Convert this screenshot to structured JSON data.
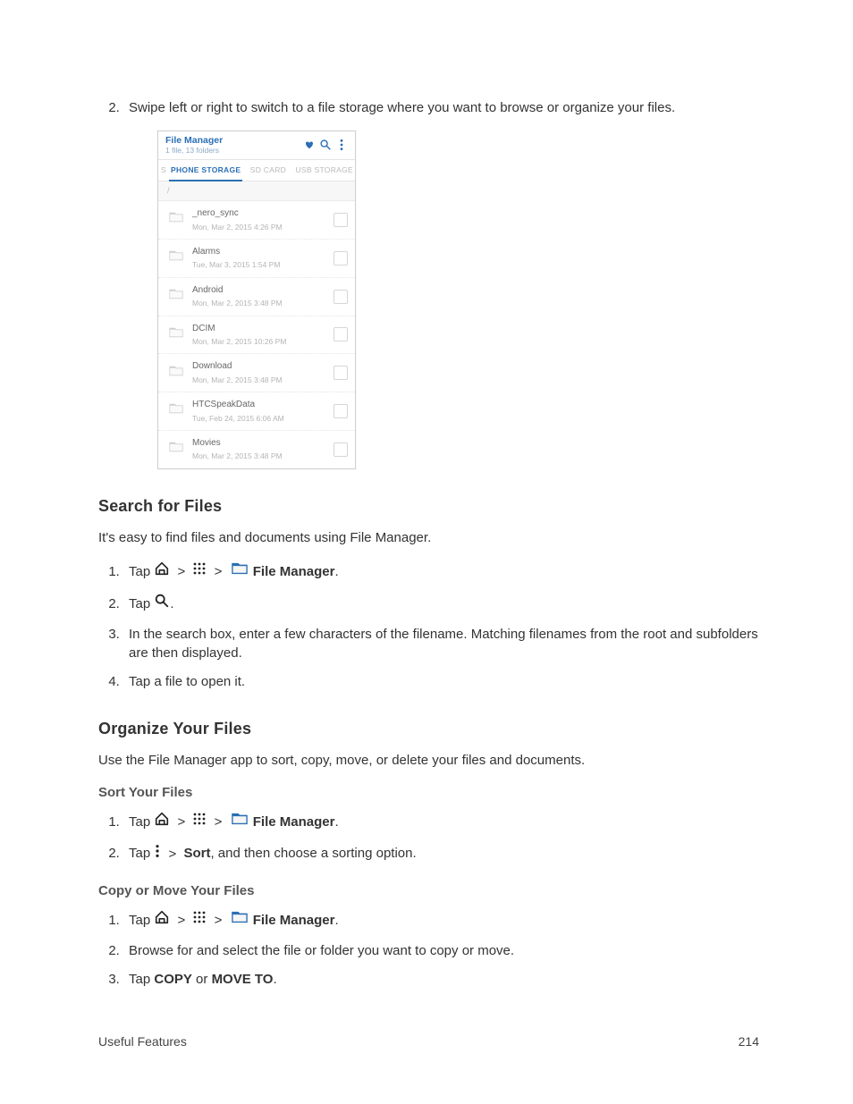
{
  "step2_text": "Swipe left or right to switch to a file storage where you want to browse or organize your files.",
  "file_manager_mock": {
    "title": "File Manager",
    "subtitle": "1 file, 13 folders",
    "tabs": {
      "left_edge": "S",
      "phone": "PHONE STORAGE",
      "sd": "SD CARD",
      "usb": "USB STORAGE"
    },
    "path": "/",
    "items": [
      {
        "name": "_nero_sync",
        "date": "Mon, Mar 2, 2015 4:26 PM"
      },
      {
        "name": "Alarms",
        "date": "Tue, Mar 3, 2015 1:54 PM"
      },
      {
        "name": "Android",
        "date": "Mon, Mar 2, 2015 3:48 PM"
      },
      {
        "name": "DCIM",
        "date": "Mon, Mar 2, 2015 10:26 PM"
      },
      {
        "name": "Download",
        "date": "Mon, Mar 2, 2015 3:48 PM"
      },
      {
        "name": "HTCSpeakData",
        "date": "Tue, Feb 24, 2015 6:06 AM"
      },
      {
        "name": "Movies",
        "date": "Mon, Mar 2, 2015 3:48 PM"
      }
    ]
  },
  "search": {
    "heading": "Search for Files",
    "intro": "It's easy to find files and documents using File Manager.",
    "step1_tap": "Tap",
    "step1_fm": "File Manager",
    "step1_period": ".",
    "step2_tap": "Tap",
    "step2_period": ".",
    "step3": "In the search box, enter a few characters of the filename. Matching filenames from the root and subfolders are then displayed.",
    "step4": "Tap a file to open it."
  },
  "organize": {
    "heading": "Organize Your Files",
    "intro": "Use the File Manager app to sort, copy, move, or delete your files and documents.",
    "sort": {
      "heading": "Sort Your Files",
      "step1_tap": "Tap",
      "step1_fm": "File Manager",
      "step1_period": ".",
      "step2_tap": "Tap",
      "step2_gt": ">",
      "step2_sort": "Sort",
      "step2_rest": ", and then choose a sorting option."
    },
    "copy": {
      "heading": "Copy or Move Your Files",
      "step1_tap": "Tap",
      "step1_fm": "File Manager",
      "step1_period": ".",
      "step2": "Browse for and select the file or folder you want to copy or move.",
      "step3_tap": "Tap ",
      "step3_copy": "COPY",
      "step3_or": " or ",
      "step3_move": "MOVE TO",
      "step3_period": "."
    }
  },
  "glyphs": {
    "gt": ">"
  },
  "footer": {
    "left": "Useful Features",
    "right": "214"
  }
}
